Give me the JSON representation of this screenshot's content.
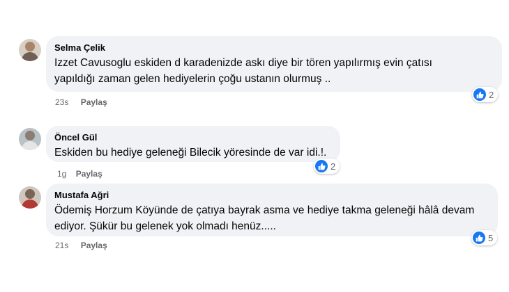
{
  "colors": {
    "bubble": "#f0f2f5",
    "like_blue": "#1877f2",
    "meta_gray": "#65676b"
  },
  "comments": [
    {
      "author": "Selma Çelik",
      "text_lines": [
        "Izzet Cavusoglu eskiden d karadenizde askı diye bir tören yapılırmış evin çatısı",
        "yapıldığı zaman gelen hediyelerin çoğu ustanın olurmuş .."
      ],
      "time": "23s",
      "share_label": "Paylaş",
      "reaction_icon": "like-icon",
      "reaction_count": "2"
    },
    {
      "author": "Öncel Gül",
      "text_lines": [
        "Eskiden bu hediye geleneği Bilecik yöresinde de var idi.!."
      ],
      "time": "1g",
      "share_label": "Paylaş",
      "reaction_icon": "like-icon",
      "reaction_count": "2"
    },
    {
      "author": "Mustafa Ağri",
      "text_lines": [
        "Ödemiş Horzum Köyünde de çatıya bayrak asma ve hediye takma geleneği hâlâ devam",
        "ediyor. Şükür bu gelenek yok olmadı henüz....."
      ],
      "time": "21s",
      "share_label": "Paylaş",
      "reaction_icon": "like-icon",
      "reaction_count": "5"
    }
  ]
}
